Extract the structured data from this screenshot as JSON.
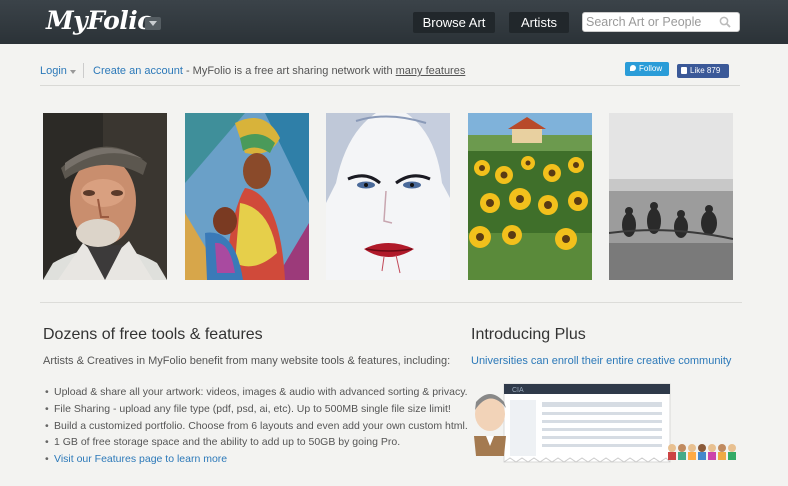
{
  "header": {
    "logo": "MyFolio",
    "nav": [
      {
        "label": "Browse Art"
      },
      {
        "label": "Artists"
      }
    ],
    "search": {
      "placeholder": "Search Art or People",
      "value": ""
    }
  },
  "subbar": {
    "login": "Login",
    "create_account": "Create an account",
    "tagline_text": " - MyFolio is a free art sharing network with ",
    "many_features": "many features",
    "twitter_label": "Follow",
    "facebook_label": "Like",
    "facebook_count": "879"
  },
  "gallery": [
    {
      "icon": "portrait-old-man-painting"
    },
    {
      "icon": "colorful-mother-child-painting"
    },
    {
      "icon": "woman-face-watercolor"
    },
    {
      "icon": "sunflowers-painting"
    },
    {
      "icon": "beach-fishermen-photo"
    }
  ],
  "tools": {
    "title": "Dozens of free tools & features",
    "intro": "Artists & Creatives in MyFolio benefit from many website tools & features, including:",
    "items": [
      "Upload & share all your artwork: videos, images & audio with advanced sorting & privacy.",
      "File Sharing - upload any file type (pdf, psd, ai, etc). Up to 500MB single file size limit!",
      "Build a customized portfolio. Choose from 6 layouts and even add your own custom html.",
      "1 GB of free storage space and the ability to add up to 50GB by going Pro.",
      "Visit our Features page to learn more"
    ]
  },
  "plus": {
    "title": "Introducing Plus",
    "link": "Universities can enroll their entire creative community"
  },
  "colors": {
    "header_bg": "#2f363b",
    "link": "#2c79b9",
    "page_bg": "#f3f3f1"
  }
}
